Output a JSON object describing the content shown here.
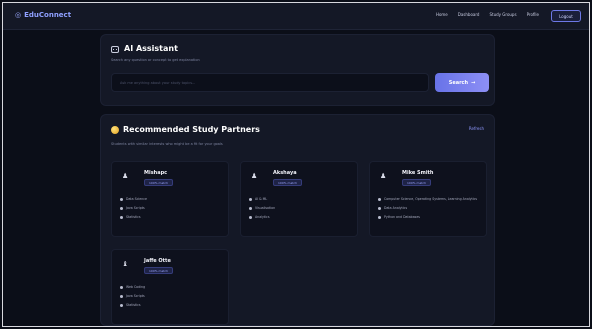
{
  "navbar": {
    "brand_icon": "◎",
    "brand_name": "EduConnect",
    "links": [
      "Home",
      "Dashboard",
      "Study Groups",
      "Profile"
    ],
    "cta": "Logout"
  },
  "ai_assistant": {
    "icon": "robot-icon",
    "title": "AI Assistant",
    "subtitle": "Search any question or concept to get explanation",
    "input_placeholder": "Ask me anything about your study topics...",
    "button_label": "Search",
    "button_arrow": "→"
  },
  "recommended": {
    "icon": "star-icon",
    "title": "Recommended Study Partners",
    "refresh_label": "Refresh",
    "subtitle": "Students with similar interests who might be a fit for your goals",
    "partners": [
      {
        "avatar": "♟",
        "name": "Mishapc",
        "badge": "100% match",
        "tags": [
          "Data Science",
          "Java Scripts",
          "Statistics"
        ]
      },
      {
        "avatar": "♟",
        "name": "Akshaya",
        "badge": "100% match",
        "tags": [
          "AI & ML",
          "Visualisation",
          "Analytics"
        ]
      },
      {
        "avatar": "♟",
        "name": "Mike Smith",
        "badge": "100% match",
        "tags": [
          "Computer Science, Operating Systems, Learning Analytics",
          "Data Analytics",
          "Python and Databases"
        ]
      },
      {
        "avatar": "♝",
        "name": "Jaffe Otte",
        "badge": "100% match",
        "tags": [
          "Web Coding",
          "Java Scripts",
          "Statistics"
        ]
      }
    ]
  },
  "colors": {
    "background": "#0b0e18",
    "card": "#141826",
    "accent": "#7b82ef",
    "brand": "#8fa0ff"
  }
}
